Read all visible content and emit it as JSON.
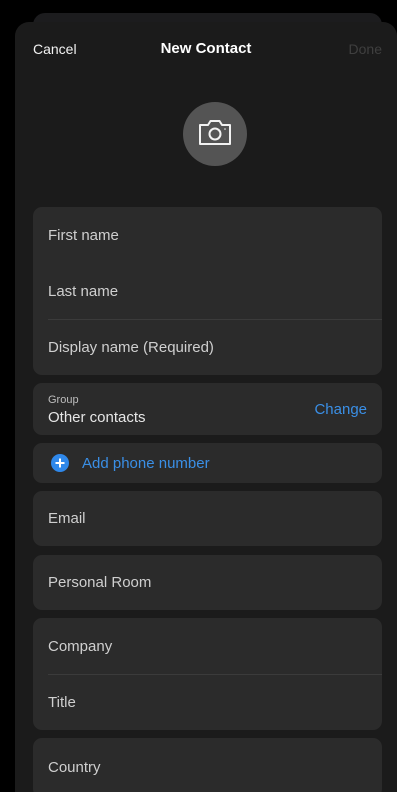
{
  "nav": {
    "cancel_label": "Cancel",
    "title": "New Contact",
    "done_label": "Done"
  },
  "avatar": {
    "icon": "camera-icon"
  },
  "name_fields": {
    "first_name_placeholder": "First name",
    "last_name_placeholder": "Last name",
    "display_name_placeholder": "Display name (Required)"
  },
  "group": {
    "label": "Group",
    "value": "Other contacts",
    "change_label": "Change"
  },
  "phone": {
    "add_label": "Add phone number",
    "icon": "plus-circle-icon"
  },
  "email": {
    "placeholder": "Email"
  },
  "personal_room": {
    "placeholder": "Personal Room"
  },
  "work": {
    "company_placeholder": "Company",
    "title_placeholder": "Title"
  },
  "country": {
    "placeholder": "Country"
  },
  "colors": {
    "background": "#000000",
    "sheet": "#1b1b1b",
    "card": "#2b2b2b",
    "accent": "#3a8fe6",
    "disabled": "#3f3f3f"
  }
}
